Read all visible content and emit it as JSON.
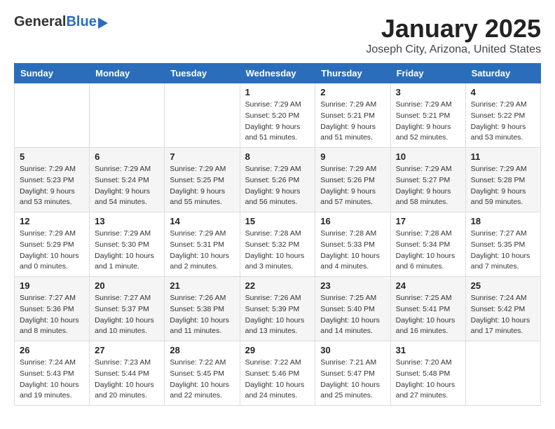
{
  "header": {
    "logo_general": "General",
    "logo_blue": "Blue",
    "month": "January 2025",
    "location": "Joseph City, Arizona, United States"
  },
  "weekdays": [
    "Sunday",
    "Monday",
    "Tuesday",
    "Wednesday",
    "Thursday",
    "Friday",
    "Saturday"
  ],
  "weeks": [
    [
      {
        "day": "",
        "info": ""
      },
      {
        "day": "",
        "info": ""
      },
      {
        "day": "",
        "info": ""
      },
      {
        "day": "1",
        "info": "Sunrise: 7:29 AM\nSunset: 5:20 PM\nDaylight: 9 hours\nand 51 minutes."
      },
      {
        "day": "2",
        "info": "Sunrise: 7:29 AM\nSunset: 5:21 PM\nDaylight: 9 hours\nand 51 minutes."
      },
      {
        "day": "3",
        "info": "Sunrise: 7:29 AM\nSunset: 5:21 PM\nDaylight: 9 hours\nand 52 minutes."
      },
      {
        "day": "4",
        "info": "Sunrise: 7:29 AM\nSunset: 5:22 PM\nDaylight: 9 hours\nand 53 minutes."
      }
    ],
    [
      {
        "day": "5",
        "info": "Sunrise: 7:29 AM\nSunset: 5:23 PM\nDaylight: 9 hours\nand 53 minutes."
      },
      {
        "day": "6",
        "info": "Sunrise: 7:29 AM\nSunset: 5:24 PM\nDaylight: 9 hours\nand 54 minutes."
      },
      {
        "day": "7",
        "info": "Sunrise: 7:29 AM\nSunset: 5:25 PM\nDaylight: 9 hours\nand 55 minutes."
      },
      {
        "day": "8",
        "info": "Sunrise: 7:29 AM\nSunset: 5:26 PM\nDaylight: 9 hours\nand 56 minutes."
      },
      {
        "day": "9",
        "info": "Sunrise: 7:29 AM\nSunset: 5:26 PM\nDaylight: 9 hours\nand 57 minutes."
      },
      {
        "day": "10",
        "info": "Sunrise: 7:29 AM\nSunset: 5:27 PM\nDaylight: 9 hours\nand 58 minutes."
      },
      {
        "day": "11",
        "info": "Sunrise: 7:29 AM\nSunset: 5:28 PM\nDaylight: 9 hours\nand 59 minutes."
      }
    ],
    [
      {
        "day": "12",
        "info": "Sunrise: 7:29 AM\nSunset: 5:29 PM\nDaylight: 10 hours\nand 0 minutes."
      },
      {
        "day": "13",
        "info": "Sunrise: 7:29 AM\nSunset: 5:30 PM\nDaylight: 10 hours\nand 1 minute."
      },
      {
        "day": "14",
        "info": "Sunrise: 7:29 AM\nSunset: 5:31 PM\nDaylight: 10 hours\nand 2 minutes."
      },
      {
        "day": "15",
        "info": "Sunrise: 7:28 AM\nSunset: 5:32 PM\nDaylight: 10 hours\nand 3 minutes."
      },
      {
        "day": "16",
        "info": "Sunrise: 7:28 AM\nSunset: 5:33 PM\nDaylight: 10 hours\nand 4 minutes."
      },
      {
        "day": "17",
        "info": "Sunrise: 7:28 AM\nSunset: 5:34 PM\nDaylight: 10 hours\nand 6 minutes."
      },
      {
        "day": "18",
        "info": "Sunrise: 7:27 AM\nSunset: 5:35 PM\nDaylight: 10 hours\nand 7 minutes."
      }
    ],
    [
      {
        "day": "19",
        "info": "Sunrise: 7:27 AM\nSunset: 5:36 PM\nDaylight: 10 hours\nand 8 minutes."
      },
      {
        "day": "20",
        "info": "Sunrise: 7:27 AM\nSunset: 5:37 PM\nDaylight: 10 hours\nand 10 minutes."
      },
      {
        "day": "21",
        "info": "Sunrise: 7:26 AM\nSunset: 5:38 PM\nDaylight: 10 hours\nand 11 minutes."
      },
      {
        "day": "22",
        "info": "Sunrise: 7:26 AM\nSunset: 5:39 PM\nDaylight: 10 hours\nand 13 minutes."
      },
      {
        "day": "23",
        "info": "Sunrise: 7:25 AM\nSunset: 5:40 PM\nDaylight: 10 hours\nand 14 minutes."
      },
      {
        "day": "24",
        "info": "Sunrise: 7:25 AM\nSunset: 5:41 PM\nDaylight: 10 hours\nand 16 minutes."
      },
      {
        "day": "25",
        "info": "Sunrise: 7:24 AM\nSunset: 5:42 PM\nDaylight: 10 hours\nand 17 minutes."
      }
    ],
    [
      {
        "day": "26",
        "info": "Sunrise: 7:24 AM\nSunset: 5:43 PM\nDaylight: 10 hours\nand 19 minutes."
      },
      {
        "day": "27",
        "info": "Sunrise: 7:23 AM\nSunset: 5:44 PM\nDaylight: 10 hours\nand 20 minutes."
      },
      {
        "day": "28",
        "info": "Sunrise: 7:22 AM\nSunset: 5:45 PM\nDaylight: 10 hours\nand 22 minutes."
      },
      {
        "day": "29",
        "info": "Sunrise: 7:22 AM\nSunset: 5:46 PM\nDaylight: 10 hours\nand 24 minutes."
      },
      {
        "day": "30",
        "info": "Sunrise: 7:21 AM\nSunset: 5:47 PM\nDaylight: 10 hours\nand 25 minutes."
      },
      {
        "day": "31",
        "info": "Sunrise: 7:20 AM\nSunset: 5:48 PM\nDaylight: 10 hours\nand 27 minutes."
      },
      {
        "day": "",
        "info": ""
      }
    ]
  ]
}
